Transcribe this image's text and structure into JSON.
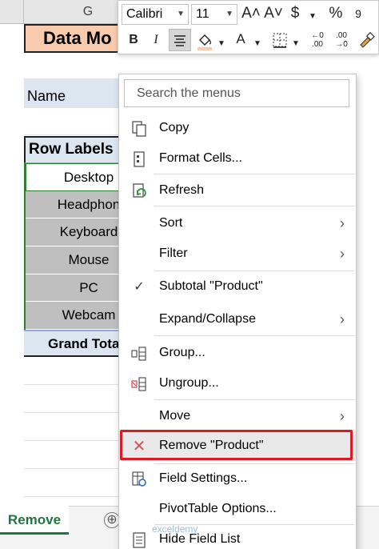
{
  "sheet": {
    "column_g": "G",
    "title": "Data Mo",
    "name_label": "Name",
    "row_labels": "Row Labels",
    "items": [
      "Desktop",
      "Headphon",
      "Keyboard",
      "Mouse",
      "PC",
      "Webcam"
    ],
    "grand_total": "Grand Tota",
    "active_tab": "Remove",
    "add_sheet": "⊕"
  },
  "mini_toolbar": {
    "font_name": "Calibri",
    "font_size": "11",
    "grow_font": "A˄",
    "shrink_font": "A˅",
    "currency": "$",
    "percent": "%",
    "bold": "B",
    "italic": "I",
    "font_color": "A"
  },
  "context_menu": {
    "search_placeholder": "Search the menus",
    "items": [
      {
        "label": "Copy",
        "icon": "copy-icon"
      },
      {
        "label": "Format Cells...",
        "icon": "format-cells-icon"
      },
      {
        "label": "Refresh",
        "icon": "refresh-icon"
      },
      {
        "label": "Sort",
        "submenu": true
      },
      {
        "label": "Filter",
        "submenu": true
      },
      {
        "label": "Subtotal \"Product\"",
        "checked": true
      },
      {
        "label": "Expand/Collapse",
        "submenu": true
      },
      {
        "label": "Group...",
        "icon": "group-icon"
      },
      {
        "label": "Ungroup...",
        "icon": "ungroup-icon"
      },
      {
        "label": "Move",
        "submenu": true
      },
      {
        "label": "Remove \"Product\"",
        "icon": "remove-icon",
        "highlighted": true
      },
      {
        "label": "Field Settings...",
        "icon": "field-settings-icon"
      },
      {
        "label": "PivotTable Options..."
      },
      {
        "label": "Hide Field List",
        "icon": "field-list-icon"
      }
    ],
    "highlight_color": "#d81b24"
  },
  "watermark": "exceldemy"
}
